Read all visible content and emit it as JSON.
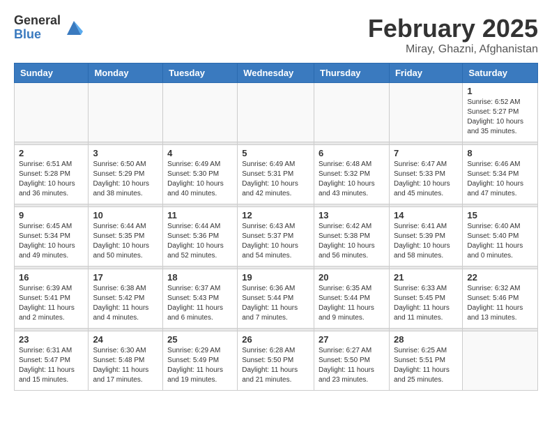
{
  "header": {
    "logo_general": "General",
    "logo_blue": "Blue",
    "month_title": "February 2025",
    "location": "Miray, Ghazni, Afghanistan"
  },
  "weekdays": [
    "Sunday",
    "Monday",
    "Tuesday",
    "Wednesday",
    "Thursday",
    "Friday",
    "Saturday"
  ],
  "weeks": [
    [
      {
        "day": "",
        "info": ""
      },
      {
        "day": "",
        "info": ""
      },
      {
        "day": "",
        "info": ""
      },
      {
        "day": "",
        "info": ""
      },
      {
        "day": "",
        "info": ""
      },
      {
        "day": "",
        "info": ""
      },
      {
        "day": "1",
        "info": "Sunrise: 6:52 AM\nSunset: 5:27 PM\nDaylight: 10 hours and 35 minutes."
      }
    ],
    [
      {
        "day": "2",
        "info": "Sunrise: 6:51 AM\nSunset: 5:28 PM\nDaylight: 10 hours and 36 minutes."
      },
      {
        "day": "3",
        "info": "Sunrise: 6:50 AM\nSunset: 5:29 PM\nDaylight: 10 hours and 38 minutes."
      },
      {
        "day": "4",
        "info": "Sunrise: 6:49 AM\nSunset: 5:30 PM\nDaylight: 10 hours and 40 minutes."
      },
      {
        "day": "5",
        "info": "Sunrise: 6:49 AM\nSunset: 5:31 PM\nDaylight: 10 hours and 42 minutes."
      },
      {
        "day": "6",
        "info": "Sunrise: 6:48 AM\nSunset: 5:32 PM\nDaylight: 10 hours and 43 minutes."
      },
      {
        "day": "7",
        "info": "Sunrise: 6:47 AM\nSunset: 5:33 PM\nDaylight: 10 hours and 45 minutes."
      },
      {
        "day": "8",
        "info": "Sunrise: 6:46 AM\nSunset: 5:34 PM\nDaylight: 10 hours and 47 minutes."
      }
    ],
    [
      {
        "day": "9",
        "info": "Sunrise: 6:45 AM\nSunset: 5:34 PM\nDaylight: 10 hours and 49 minutes."
      },
      {
        "day": "10",
        "info": "Sunrise: 6:44 AM\nSunset: 5:35 PM\nDaylight: 10 hours and 50 minutes."
      },
      {
        "day": "11",
        "info": "Sunrise: 6:44 AM\nSunset: 5:36 PM\nDaylight: 10 hours and 52 minutes."
      },
      {
        "day": "12",
        "info": "Sunrise: 6:43 AM\nSunset: 5:37 PM\nDaylight: 10 hours and 54 minutes."
      },
      {
        "day": "13",
        "info": "Sunrise: 6:42 AM\nSunset: 5:38 PM\nDaylight: 10 hours and 56 minutes."
      },
      {
        "day": "14",
        "info": "Sunrise: 6:41 AM\nSunset: 5:39 PM\nDaylight: 10 hours and 58 minutes."
      },
      {
        "day": "15",
        "info": "Sunrise: 6:40 AM\nSunset: 5:40 PM\nDaylight: 11 hours and 0 minutes."
      }
    ],
    [
      {
        "day": "16",
        "info": "Sunrise: 6:39 AM\nSunset: 5:41 PM\nDaylight: 11 hours and 2 minutes."
      },
      {
        "day": "17",
        "info": "Sunrise: 6:38 AM\nSunset: 5:42 PM\nDaylight: 11 hours and 4 minutes."
      },
      {
        "day": "18",
        "info": "Sunrise: 6:37 AM\nSunset: 5:43 PM\nDaylight: 11 hours and 6 minutes."
      },
      {
        "day": "19",
        "info": "Sunrise: 6:36 AM\nSunset: 5:44 PM\nDaylight: 11 hours and 7 minutes."
      },
      {
        "day": "20",
        "info": "Sunrise: 6:35 AM\nSunset: 5:44 PM\nDaylight: 11 hours and 9 minutes."
      },
      {
        "day": "21",
        "info": "Sunrise: 6:33 AM\nSunset: 5:45 PM\nDaylight: 11 hours and 11 minutes."
      },
      {
        "day": "22",
        "info": "Sunrise: 6:32 AM\nSunset: 5:46 PM\nDaylight: 11 hours and 13 minutes."
      }
    ],
    [
      {
        "day": "23",
        "info": "Sunrise: 6:31 AM\nSunset: 5:47 PM\nDaylight: 11 hours and 15 minutes."
      },
      {
        "day": "24",
        "info": "Sunrise: 6:30 AM\nSunset: 5:48 PM\nDaylight: 11 hours and 17 minutes."
      },
      {
        "day": "25",
        "info": "Sunrise: 6:29 AM\nSunset: 5:49 PM\nDaylight: 11 hours and 19 minutes."
      },
      {
        "day": "26",
        "info": "Sunrise: 6:28 AM\nSunset: 5:50 PM\nDaylight: 11 hours and 21 minutes."
      },
      {
        "day": "27",
        "info": "Sunrise: 6:27 AM\nSunset: 5:50 PM\nDaylight: 11 hours and 23 minutes."
      },
      {
        "day": "28",
        "info": "Sunrise: 6:25 AM\nSunset: 5:51 PM\nDaylight: 11 hours and 25 minutes."
      },
      {
        "day": "",
        "info": ""
      }
    ]
  ]
}
